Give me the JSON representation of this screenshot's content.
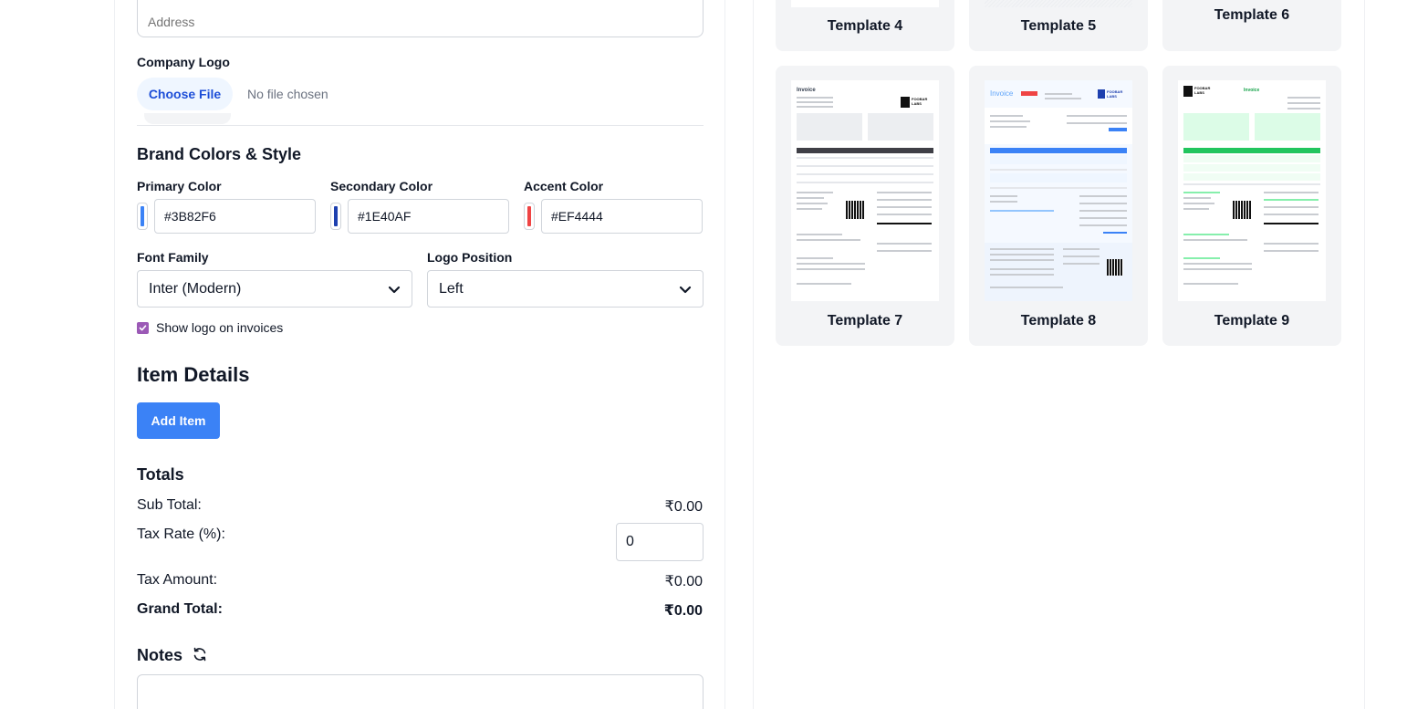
{
  "company": {
    "address_placeholder": "Address",
    "logo_label": "Company Logo",
    "choose_file_label": "Choose File",
    "no_file_text": "No file chosen"
  },
  "brand": {
    "heading": "Brand Colors & Style",
    "primary_label": "Primary Color",
    "primary_value": "#3B82F6",
    "secondary_label": "Secondary Color",
    "secondary_value": "#1E40AF",
    "accent_label": "Accent Color",
    "accent_value": "#EF4444",
    "font_label": "Font Family",
    "font_value": "Inter (Modern)",
    "logo_position_label": "Logo Position",
    "logo_position_value": "Left",
    "show_logo_label": "Show logo on invoices",
    "show_logo_checked": true
  },
  "items": {
    "heading": "Item Details",
    "add_button": "Add Item"
  },
  "totals": {
    "heading": "Totals",
    "subtotal_label": "Sub Total:",
    "subtotal_value": "₹0.00",
    "tax_rate_label": "Tax Rate (%):",
    "tax_rate_value": "0",
    "tax_amount_label": "Tax Amount:",
    "tax_amount_value": "₹0.00",
    "grand_total_label": "Grand Total:",
    "grand_total_value": "₹0.00"
  },
  "notes": {
    "heading": "Notes"
  },
  "templates": [
    {
      "label": "Template 4"
    },
    {
      "label": "Template 5"
    },
    {
      "label": "Template 6"
    },
    {
      "label": "Template 7"
    },
    {
      "label": "Template 8"
    },
    {
      "label": "Template 9"
    }
  ],
  "template_previews": {
    "t7_title": "Invoice",
    "t7_logo": "FOOBAR LABS",
    "t8_title": "Invoice",
    "t8_logo": "FOOBAR LABS",
    "t9_title": "Invoice",
    "t9_logo": "FOOBAR LABS"
  },
  "colors": {
    "primary": "#3B82F6",
    "secondary": "#1E40AF",
    "accent": "#EF4444",
    "checkbox": "#9B59B6"
  }
}
